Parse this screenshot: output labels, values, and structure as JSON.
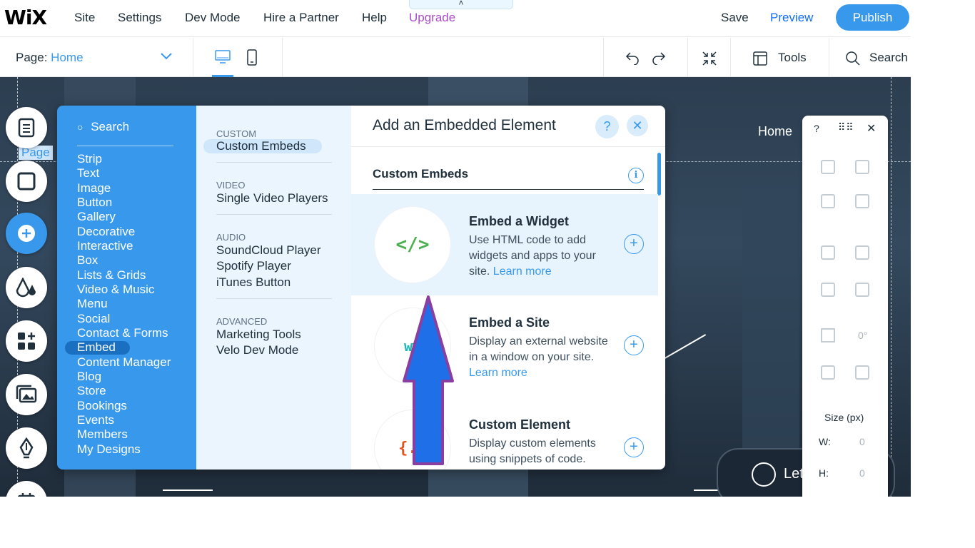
{
  "topbar": {
    "logo": "WiX",
    "menu": [
      "Site",
      "Settings",
      "Dev Mode",
      "Hire a Partner",
      "Help",
      "Upgrade"
    ],
    "collapse_glyph": "˄",
    "save": "Save",
    "preview": "Preview",
    "publish": "Publish"
  },
  "subbar": {
    "page_prefix": "Page:",
    "page_name": "Home",
    "tools": "Tools",
    "search": "Search"
  },
  "canvas": {
    "page_tag": "Page",
    "nav_home": "Home",
    "chat": "Let's Chat!"
  },
  "add_panel": {
    "search": "Search",
    "categories": [
      "Strip",
      "Text",
      "Image",
      "Button",
      "Gallery",
      "Decorative",
      "Interactive",
      "Box",
      "Lists & Grids",
      "Video & Music",
      "Menu",
      "Social",
      "Contact & Forms",
      "Embed",
      "Content Manager",
      "Blog",
      "Store",
      "Bookings",
      "Events",
      "Members",
      "My Designs"
    ],
    "selected_category": "Embed",
    "sub_sections": [
      {
        "head": "CUSTOM",
        "items": [
          "Custom Embeds"
        ]
      },
      {
        "head": "VIDEO",
        "items": [
          "Single Video Players"
        ]
      },
      {
        "head": "AUDIO",
        "items": [
          "SoundCloud Player",
          "Spotify Player",
          "iTunes Button"
        ]
      },
      {
        "head": "ADVANCED",
        "items": [
          "Marketing Tools",
          "Velo Dev Mode"
        ]
      }
    ],
    "detail_title": "Add an Embedded Element",
    "help": "?",
    "close": "✕",
    "section_title": "Custom Embeds",
    "info": "i",
    "cards": [
      {
        "title": "Embed a Widget",
        "desc": "Use HTML code to add widgets and apps to your site.",
        "link": "Learn more",
        "thumb": "</>",
        "thumb_color": "#4caf50"
      },
      {
        "title": "Embed a Site",
        "desc": "Display an external website in a window on your site.",
        "link": "Learn more",
        "thumb": "ww",
        "thumb_color": "#1fb5b5"
      },
      {
        "title": "Custom Element",
        "desc": "Display custom elements using snippets of code.",
        "link": "",
        "thumb": "{..",
        "thumb_color": "#e8501c"
      }
    ]
  },
  "right_toolbar": {
    "help": "?",
    "grip": "⠿⠿",
    "close": "✕",
    "rotation": "0°",
    "size_label": "Size (px)",
    "w_label": "W:",
    "w_value": "0",
    "h_label": "H:",
    "h_value": "0"
  },
  "colors": {
    "accent": "#3899ec",
    "upgrade": "#aa4dc8",
    "arrow_fill": "#1f6fe8",
    "arrow_stroke": "#8a3fa0"
  }
}
